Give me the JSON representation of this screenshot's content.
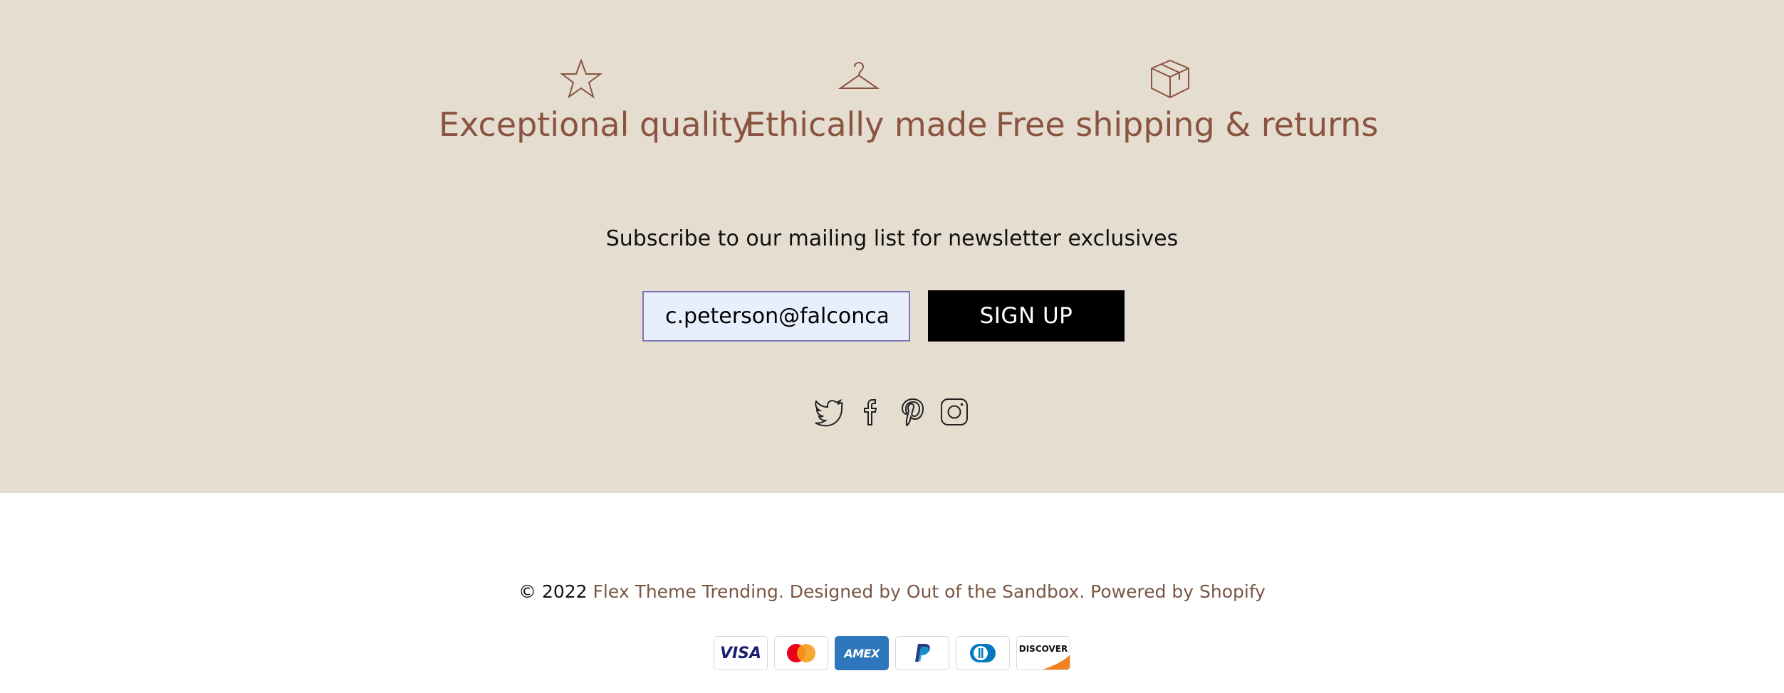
{
  "features": [
    {
      "icon": "star-icon",
      "label": "Exceptional quality"
    },
    {
      "icon": "hanger-icon",
      "label": "Ethically made"
    },
    {
      "icon": "box-icon",
      "label": "Free shipping & returns"
    }
  ],
  "newsletter": {
    "heading": "Subscribe to our mailing list for newsletter exclusives",
    "email_value": "c.peterson@falconcarwash.com",
    "button_label": "SIGN UP"
  },
  "social": [
    "twitter-icon",
    "facebook-icon",
    "pinterest-icon",
    "instagram-icon"
  ],
  "footer": {
    "copyright": "© 2022",
    "store_link": "Flex Theme Trending",
    "designed_by": "Designed by Out of the Sandbox",
    "powered_by": "Powered by Shopify"
  },
  "payments": [
    "VISA",
    "Mastercard",
    "AMEX",
    "PayPal",
    "Diners Club",
    "DISCOVER"
  ],
  "colors": {
    "accent": "#8a5441",
    "band": "#e5ddd0",
    "link": "#7a5644"
  }
}
